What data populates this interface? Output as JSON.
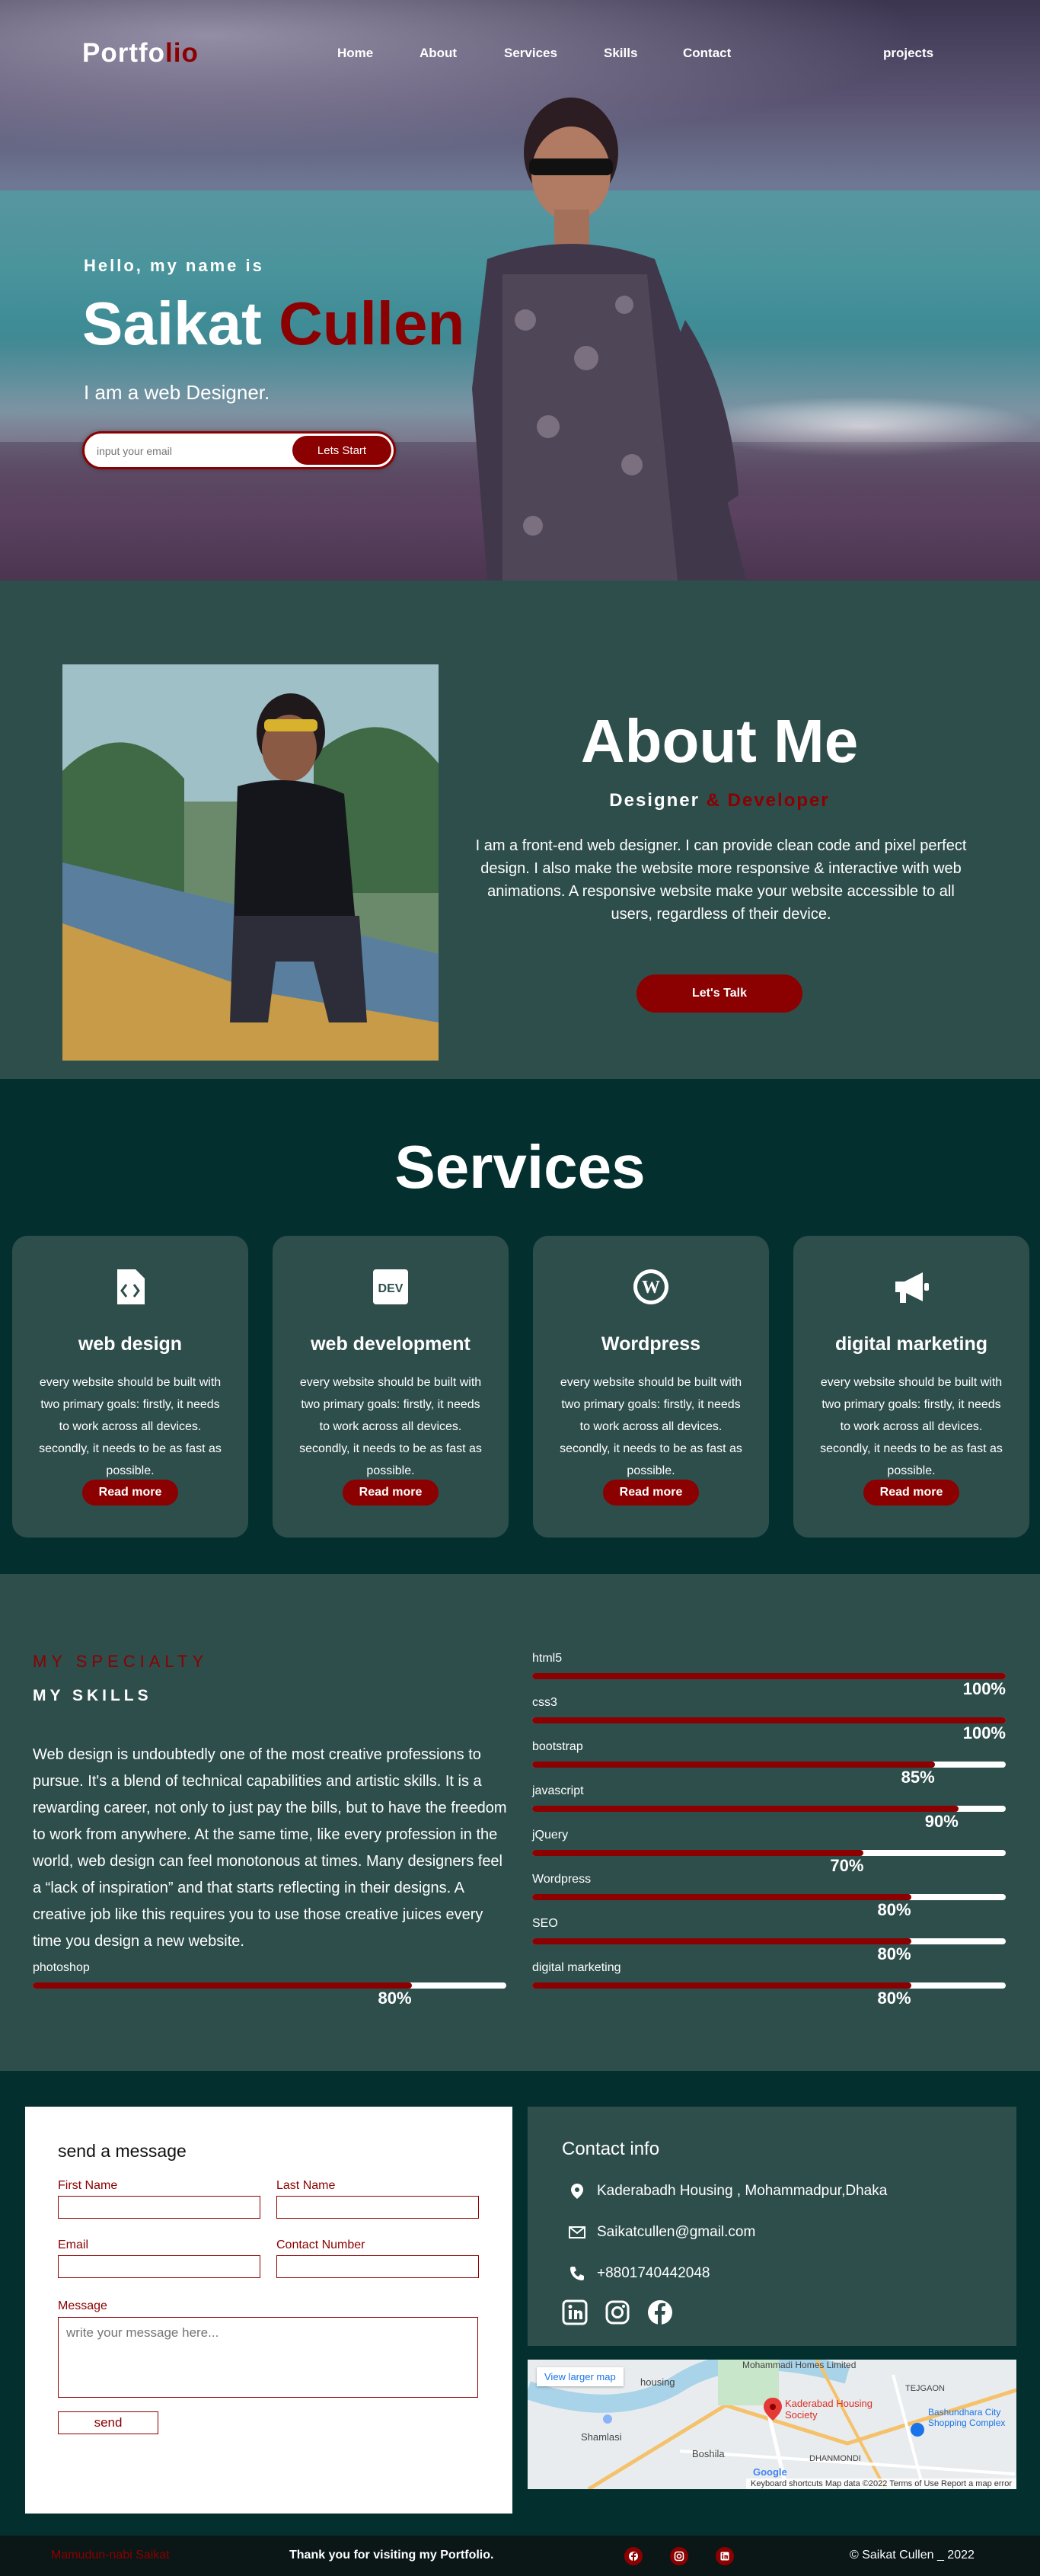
{
  "brand": {
    "part1": "Portfo",
    "part2": "lio"
  },
  "nav": {
    "home": "Home",
    "about": "About",
    "services": "Services",
    "skills": "Skills",
    "contact": "Contact",
    "projects": "projects"
  },
  "hero": {
    "greeting": "Hello, my name is",
    "first_name": "Saikat",
    "last_name": "Cullen",
    "role": "I am a web Designer.",
    "email_placeholder": "input your email",
    "cta": "Lets Start"
  },
  "about": {
    "title": "About Me",
    "subtitle_1": "Designer",
    "subtitle_2": " & Developer",
    "text": "I am a front-end web designer. I can provide clean code and pixel perfect design. I also make the website more responsive & interactive with web animations. A responsive website make your website accessible to all users, regardless of their device.",
    "button": "Let's Talk"
  },
  "services": {
    "title": "Services",
    "cards": [
      {
        "title": "web design",
        "icon": "code-file-icon",
        "text": "every website should be built with two primary goals: firstly, it needs to work across all devices. secondly, it needs to be as fast as possible.",
        "button": "Read more"
      },
      {
        "title": "web development",
        "icon": "dev-badge-icon",
        "text": "every website should be built with two primary goals: firstly, it needs to work across all devices. secondly, it needs to be as fast as possible.",
        "button": "Read more"
      },
      {
        "title": "Wordpress",
        "icon": "wordpress-icon",
        "text": "every website should be built with two primary goals: firstly, it needs to work across all devices. secondly, it needs to be as fast as possible.",
        "button": "Read more"
      },
      {
        "title": "digital marketing",
        "icon": "megaphone-icon",
        "text": "every website should be built with two primary goals: firstly, it needs to work across all devices. secondly, it needs to be as fast as possible.",
        "button": "Read more"
      }
    ]
  },
  "skills": {
    "kicker": "MY SPECIALTY",
    "title": "MY SKILLS",
    "text": "Web design is undoubtedly one of the most creative professions to pursue. It's a blend of technical capabilities and artistic skills. It is a rewarding career, not only to just pay the bills, but to have the freedom to work from anywhere. At the same time, like every profession in the world, web design can feel monotonous at times. Many designers feel a “lack of inspiration” and that starts reflecting in their designs. A creative job like this requires you to use those creative juices every time you design a new website.",
    "bars": [
      {
        "name": "html5",
        "percent": 100,
        "label": "100%"
      },
      {
        "name": "css3",
        "percent": 100,
        "label": "100%"
      },
      {
        "name": "bootstrap",
        "percent": 85,
        "label": "85%"
      },
      {
        "name": "javascript",
        "percent": 90,
        "label": "90%"
      },
      {
        "name": "jQuery",
        "percent": 70,
        "label": "70%"
      },
      {
        "name": "Wordpress",
        "percent": 80,
        "label": "80%"
      },
      {
        "name": "SEO",
        "percent": 80,
        "label": "80%"
      },
      {
        "name": "digital marketing",
        "percent": 80,
        "label": "80%"
      },
      {
        "name": "photoshop",
        "percent": 80,
        "label": "80%"
      }
    ]
  },
  "contact": {
    "form_title": "send a message",
    "first_name": "First Name",
    "last_name": "Last Name",
    "email": "Email",
    "phone": "Contact Number",
    "message": "Message",
    "message_placeholder": "write your message here...",
    "send": "send",
    "info_title": "Contact info",
    "address": "Kaderabadh Housing , Mohammadpur,Dhaka",
    "email_value": "Saikatcullen@gmail.com",
    "phone_value": "+8801740442048",
    "social": [
      "linkedin-icon",
      "instagram-icon",
      "facebook-icon"
    ]
  },
  "map": {
    "link": "View larger map",
    "pin_label": "Kaderabad Housing Society",
    "places": [
      "Mohammadi Homes Limited",
      "housing",
      "TEJGAON",
      "Bashundhara City Shopping Complex",
      "Shamlasi",
      "Boshila",
      "DHANMONDI"
    ],
    "footer": "Keyboard shortcuts   Map data ©2022   Terms of Use   Report a map error",
    "google": "Google"
  },
  "footer": {
    "left": "Mamudun-nabi Saikat",
    "middle": "Thank you for visiting my Portfolio.",
    "right": "© Saikat Cullen _ 2022"
  },
  "colors": {
    "accent": "#8b0000",
    "bg_dark": "#03302e",
    "bg_mid": "#2e4e4c"
  }
}
